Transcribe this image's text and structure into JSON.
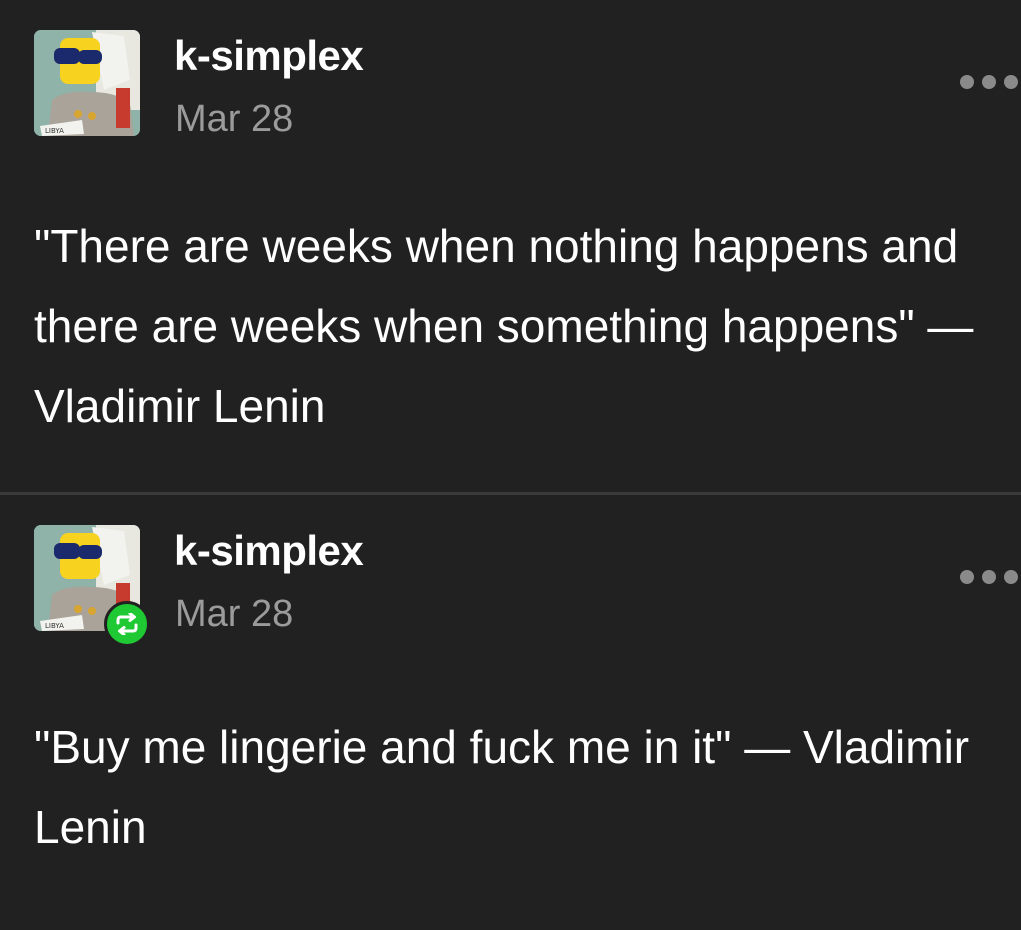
{
  "posts": [
    {
      "username": "k-simplex",
      "date": "Mar 28",
      "text": "\"There are weeks when nothing happens and there are weeks when something happens\" — Vladimir Lenin",
      "avatar_caption": "LIBYA",
      "reblogged": false,
      "menu_icon": "ellipsis-icon"
    },
    {
      "username": "k-simplex",
      "date": "Mar 28",
      "text": "\"Buy me lingerie and fuck me in it\" — Vladimir Lenin",
      "avatar_caption": "LIBYA",
      "reblogged": true,
      "badge_icon": "reblog-icon",
      "menu_icon": "ellipsis-icon"
    }
  ],
  "colors": {
    "background": "#212121",
    "text": "#ffffff",
    "muted": "#9b9b9b",
    "reblog_badge": "#1fc934",
    "divider": "#3a3a3a"
  }
}
